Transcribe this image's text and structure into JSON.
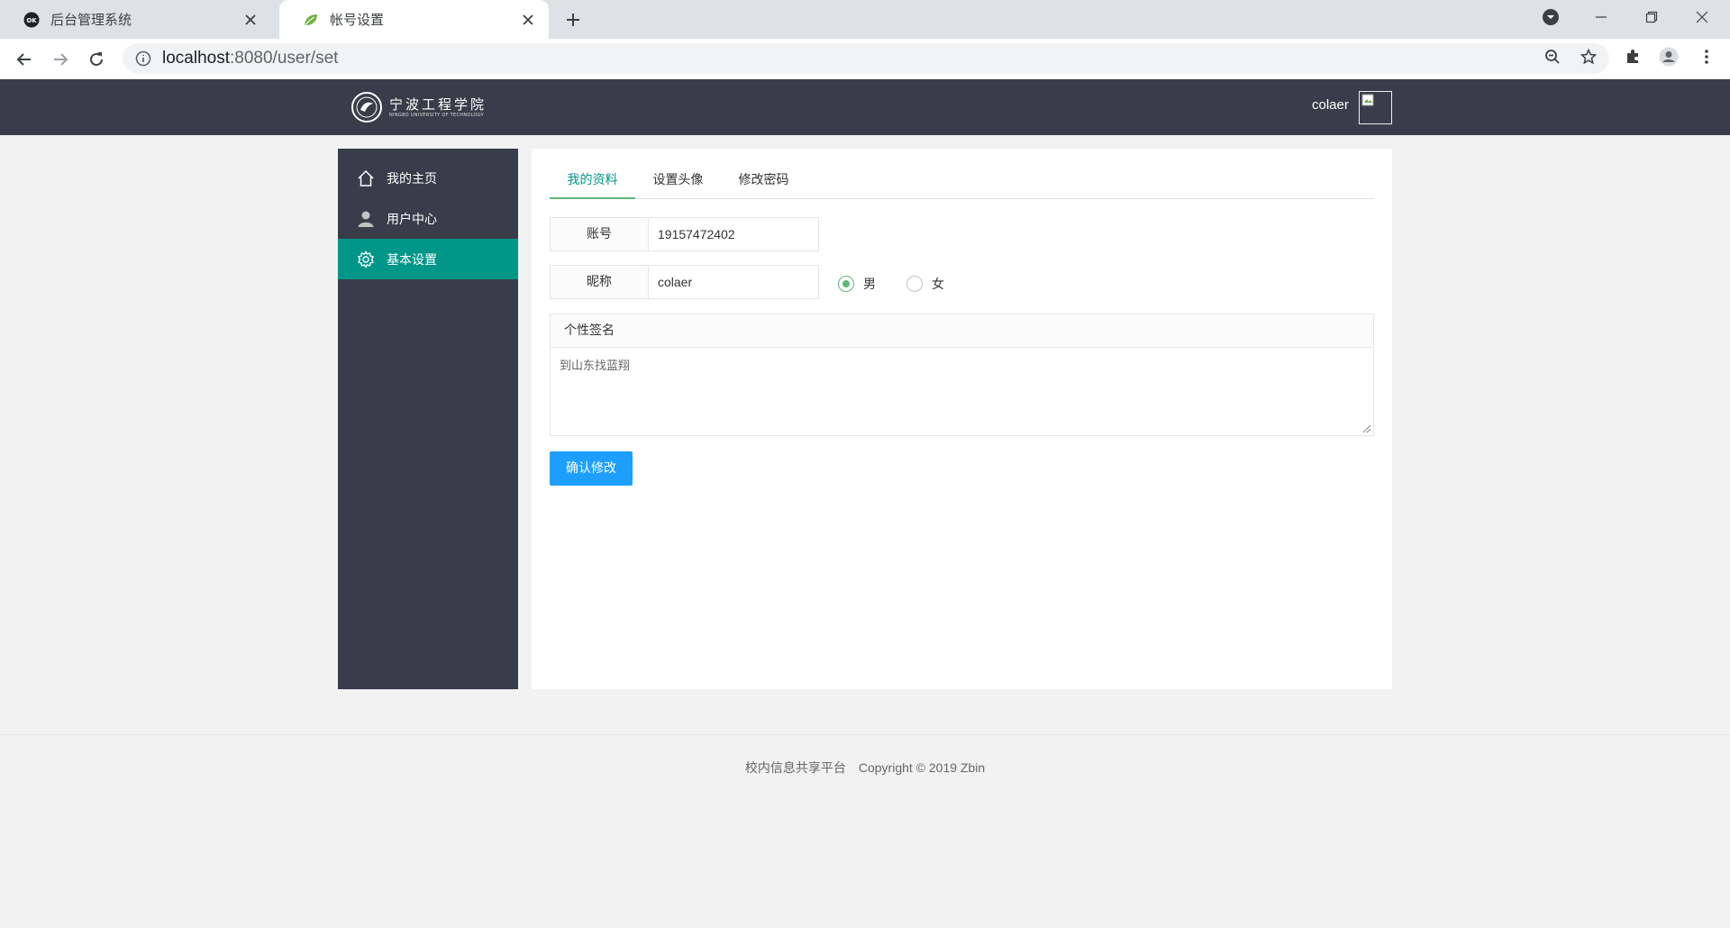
{
  "browser": {
    "tabs": [
      {
        "title": "后台管理系统",
        "active": false
      },
      {
        "title": "帐号设置",
        "active": true
      }
    ],
    "url_host": "localhost",
    "url_rest": ":8080/user/set"
  },
  "header": {
    "logo_cn": "宁波工程学院",
    "logo_en": "NINGBO UNIVERSITY OF TECHNOLOGY",
    "username": "colaer"
  },
  "sidebar": {
    "items": [
      {
        "label": "我的主页",
        "icon": "home-icon",
        "active": false
      },
      {
        "label": "用户中心",
        "icon": "user-icon",
        "active": false
      },
      {
        "label": "基本设置",
        "icon": "gear-icon",
        "active": true
      }
    ]
  },
  "main": {
    "tabs": [
      {
        "label": "我的资料",
        "active": true
      },
      {
        "label": "设置头像",
        "active": false
      },
      {
        "label": "修改密码",
        "active": false
      }
    ],
    "account": {
      "label": "账号",
      "value": "19157472402"
    },
    "nickname": {
      "label": "昵称",
      "value": "colaer"
    },
    "gender": {
      "options": [
        "男",
        "女"
      ],
      "selected": "男"
    },
    "signature": {
      "label": "个性签名",
      "value": "到山东找蓝翔"
    },
    "submit_label": "确认修改"
  },
  "footer": {
    "platform": "校内信息共享平台",
    "copyright": "Copyright  © 2019 Zbin"
  },
  "colors": {
    "header_bg": "#393d49",
    "active_green": "#009688",
    "primary_blue": "#1e9fff",
    "radio_green": "#5fb878"
  }
}
